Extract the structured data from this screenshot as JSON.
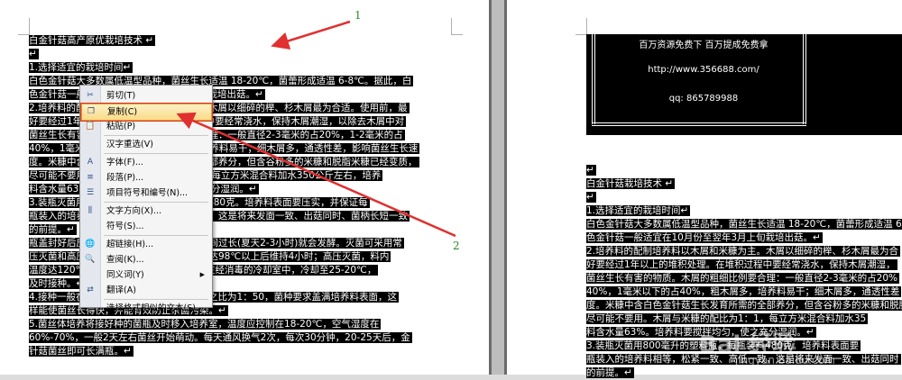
{
  "left_doc": {
    "lines": [
      "白金针菇高产原优栽培技术 ↵",
      "↵",
      "   1.选择适宜的栽培时间↵",
      "白色金针菇大多数属低温型品种，菌丝生长适温 18-20℃，菌蕾形成适温 6-8℃。据此，白",
      "色金针菇一般适宜在10月份至翌年3月上旬栽培出菇。↵",
      "2.培养料的配制培养料以木屑和米糠为主。木屑以细碎的榉、杉木屑最为合适。使用前，最",
      "好要经过1年以上的堆积处理。在堆积过程中要经常浇水，保持木屑潮湿，以除去木屑中对",
      "菌丝生长有害的物质。木屑的粗细比例要合理：一般直径2-3毫米的占20%，1-2毫米的占",
      "40%，1毫米以下的占40%，粗木屑多，培养料易干；细木屑多，通透性差，影响菌丝生长速",
      "度。米糠中含白色金针菇生长发育所需的全部养分，但含谷粉多的米糠和脱脂米糠已经变质，",
      "尽可能不要用。木屑与米糠的配比为1：1，每立方米混合料加水350公斤左右，培养",
      "料含水量63%。培养料要搅拌均匀，使之充分湿润。↵",
      "3.装瓶灭菌用800毫升的塑料瓶，每瓶装料480克。培养料表面要压实，并保证每",
      "瓶装入的培养料相等，松紧一致、高低一致，这是将来发面一致、出菇同时、菌柄长短一致",
      "的前提。↵",
      "瓶盖封好后应立即送入高压锅灭菌，装料时间过长(夏天2-3小时)就会发酵。灭菌可采用常",
      "压灭菌和高压灭菌，常压灭菌：当锅内温度达98℃以上后维持4小时；高压灭菌，料内",
      "温度达120℃时保持1小时。灭菌后趁热放在经消毒的冷却室中，冷却至25-20℃，",
      "及时接种。↵",
      "4.接种一般在接种箱内进行，菌种和培养料之比为1：50，菌种要求盖满培养料表面，这",
      "样能使菌丝长得快，并能有效防止杂菌污染。↵",
      "5.菌丝体培养将接好种的菌瓶及时移入培养室，温度应控制在18-20℃，空气湿度在",
      "60%-70%，一般2天左右菌丝开始萌动。每天通风换气2次，每次30分钟，20-25天后，金",
      "针菇菌丝即可长满瓶。↵"
    ]
  },
  "right_doc": {
    "header_lines": [
      "百万资源免费下  百万提成免费拿",
      "http://www.356688.com/",
      "qq: 865789988"
    ],
    "lines": [
      "↵",
      "白金针菇栽培技术 ↵",
      "↵",
      "   1.选择适宜的栽培时间↵",
      "白色金针菇大多数属低温型品种，菌丝生长适温 18-20℃，菌蕾形成适温 6",
      "色金针菇一般适宜在10月份至翌年3月上旬栽培出菇。↵",
      "2.培养料的配制培养料以木屑和米糠为主。木屑以细碎的榉、杉木屑最为合",
      "好要经过1年以上的堆积处理。在堆积过程中要经常浇水，保持木屑潮湿，",
      "菌丝生长有害的物质。木屑的粗细比例要合理：一般直径2-3毫米的占20%",
      "40%，1毫米以下的占40%，粗木屑多，培养料易干；细木屑多，通透性差",
      "度。米糠中含白色金针菇生长发育所需的全部养分，但含谷粉多的米糠和脱脂",
      "尽可能不要用。木屑与米糠的配比为1：1，每立方米混合料加水35",
      "料含水量63%。培养料要搅拌均匀，使之充分湿润。↵",
      "3.装瓶灭菌用800毫升的塑料瓶，每瓶装料480克。培养料表面要",
      "瓶装入的培养料相等，松紧一致、高低一致，这是将来发面一致、出菇同时",
      "的前提。↵"
    ]
  },
  "context_menu": {
    "items": [
      {
        "label": "剪切(T)",
        "icon": "scissors-icon",
        "glyph": "✂"
      },
      {
        "label": "复制(C)",
        "icon": "copy-icon",
        "glyph": "❐",
        "highlight": true
      },
      {
        "label": "粘贴(P)",
        "icon": "paste-icon",
        "glyph": "📋"
      },
      {
        "label": "汉字重选(V)",
        "icon": "",
        "glyph": ""
      },
      {
        "label": "字体(F)...",
        "icon": "font-icon",
        "glyph": "A"
      },
      {
        "label": "段落(P)...",
        "icon": "paragraph-icon",
        "glyph": "≡"
      },
      {
        "label": "项目符号和编号(N)...",
        "icon": "bullets-icon",
        "glyph": "☰"
      },
      {
        "label": "文字方向(X)...",
        "icon": "text-direction-icon",
        "glyph": "⫼"
      },
      {
        "label": "符号(S)...",
        "icon": "",
        "glyph": ""
      },
      {
        "label": "超链接(H)...",
        "icon": "hyperlink-icon",
        "glyph": "🌐"
      },
      {
        "label": "查阅(K)...",
        "icon": "research-icon",
        "glyph": "🔍"
      },
      {
        "label": "同义词(Y)",
        "icon": "",
        "glyph": "",
        "submenu": true
      },
      {
        "label": "翻译(A)",
        "icon": "translate-icon",
        "glyph": "⇄"
      },
      {
        "label": "选择格式相似的文本(S)",
        "icon": "",
        "glyph": ""
      }
    ]
  },
  "annotations": {
    "label_1": "1",
    "label_2": "2",
    "arrow_color": "#e03030",
    "label_color": "#2a8a2a"
  },
  "watermark": {
    "text": "Bai 经验",
    "url": "jingyan.baidu.com"
  }
}
